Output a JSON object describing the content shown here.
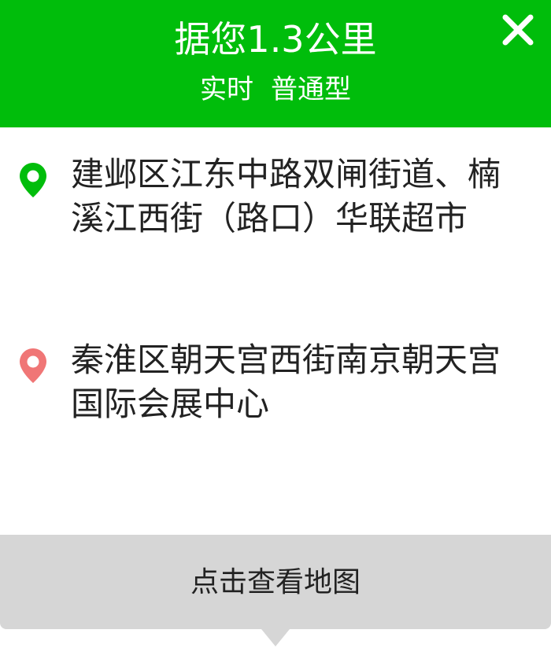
{
  "header": {
    "distance_text": "据您1.3公里",
    "mode": "实时",
    "type": "普通型",
    "close_icon": "close-icon",
    "color": "#00bd0b"
  },
  "locations": {
    "from": {
      "address": "建邺区江东中路双闸街道、楠溪江西街（路口）华联超市",
      "icon": "map-pin-icon",
      "color": "#00bd0b"
    },
    "to": {
      "address": "秦淮区朝天宫西街南京朝天宫国际会展中心",
      "icon": "map-pin-icon",
      "color": "#f07676"
    }
  },
  "footer": {
    "view_map_label": "点击查看地图"
  }
}
